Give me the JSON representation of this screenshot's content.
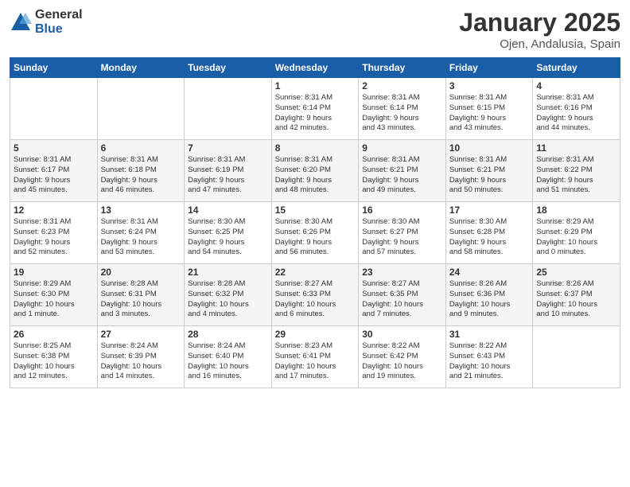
{
  "logo": {
    "general": "General",
    "blue": "Blue"
  },
  "header": {
    "month": "January 2025",
    "location": "Ojen, Andalusia, Spain"
  },
  "weekdays": [
    "Sunday",
    "Monday",
    "Tuesday",
    "Wednesday",
    "Thursday",
    "Friday",
    "Saturday"
  ],
  "weeks": [
    [
      {
        "day": "",
        "info": ""
      },
      {
        "day": "",
        "info": ""
      },
      {
        "day": "",
        "info": ""
      },
      {
        "day": "1",
        "info": "Sunrise: 8:31 AM\nSunset: 6:14 PM\nDaylight: 9 hours\nand 42 minutes."
      },
      {
        "day": "2",
        "info": "Sunrise: 8:31 AM\nSunset: 6:14 PM\nDaylight: 9 hours\nand 43 minutes."
      },
      {
        "day": "3",
        "info": "Sunrise: 8:31 AM\nSunset: 6:15 PM\nDaylight: 9 hours\nand 43 minutes."
      },
      {
        "day": "4",
        "info": "Sunrise: 8:31 AM\nSunset: 6:16 PM\nDaylight: 9 hours\nand 44 minutes."
      }
    ],
    [
      {
        "day": "5",
        "info": "Sunrise: 8:31 AM\nSunset: 6:17 PM\nDaylight: 9 hours\nand 45 minutes."
      },
      {
        "day": "6",
        "info": "Sunrise: 8:31 AM\nSunset: 6:18 PM\nDaylight: 9 hours\nand 46 minutes."
      },
      {
        "day": "7",
        "info": "Sunrise: 8:31 AM\nSunset: 6:19 PM\nDaylight: 9 hours\nand 47 minutes."
      },
      {
        "day": "8",
        "info": "Sunrise: 8:31 AM\nSunset: 6:20 PM\nDaylight: 9 hours\nand 48 minutes."
      },
      {
        "day": "9",
        "info": "Sunrise: 8:31 AM\nSunset: 6:21 PM\nDaylight: 9 hours\nand 49 minutes."
      },
      {
        "day": "10",
        "info": "Sunrise: 8:31 AM\nSunset: 6:21 PM\nDaylight: 9 hours\nand 50 minutes."
      },
      {
        "day": "11",
        "info": "Sunrise: 8:31 AM\nSunset: 6:22 PM\nDaylight: 9 hours\nand 51 minutes."
      }
    ],
    [
      {
        "day": "12",
        "info": "Sunrise: 8:31 AM\nSunset: 6:23 PM\nDaylight: 9 hours\nand 52 minutes."
      },
      {
        "day": "13",
        "info": "Sunrise: 8:31 AM\nSunset: 6:24 PM\nDaylight: 9 hours\nand 53 minutes."
      },
      {
        "day": "14",
        "info": "Sunrise: 8:30 AM\nSunset: 6:25 PM\nDaylight: 9 hours\nand 54 minutes."
      },
      {
        "day": "15",
        "info": "Sunrise: 8:30 AM\nSunset: 6:26 PM\nDaylight: 9 hours\nand 56 minutes."
      },
      {
        "day": "16",
        "info": "Sunrise: 8:30 AM\nSunset: 6:27 PM\nDaylight: 9 hours\nand 57 minutes."
      },
      {
        "day": "17",
        "info": "Sunrise: 8:30 AM\nSunset: 6:28 PM\nDaylight: 9 hours\nand 58 minutes."
      },
      {
        "day": "18",
        "info": "Sunrise: 8:29 AM\nSunset: 6:29 PM\nDaylight: 10 hours\nand 0 minutes."
      }
    ],
    [
      {
        "day": "19",
        "info": "Sunrise: 8:29 AM\nSunset: 6:30 PM\nDaylight: 10 hours\nand 1 minute."
      },
      {
        "day": "20",
        "info": "Sunrise: 8:28 AM\nSunset: 6:31 PM\nDaylight: 10 hours\nand 3 minutes."
      },
      {
        "day": "21",
        "info": "Sunrise: 8:28 AM\nSunset: 6:32 PM\nDaylight: 10 hours\nand 4 minutes."
      },
      {
        "day": "22",
        "info": "Sunrise: 8:27 AM\nSunset: 6:33 PM\nDaylight: 10 hours\nand 6 minutes."
      },
      {
        "day": "23",
        "info": "Sunrise: 8:27 AM\nSunset: 6:35 PM\nDaylight: 10 hours\nand 7 minutes."
      },
      {
        "day": "24",
        "info": "Sunrise: 8:26 AM\nSunset: 6:36 PM\nDaylight: 10 hours\nand 9 minutes."
      },
      {
        "day": "25",
        "info": "Sunrise: 8:26 AM\nSunset: 6:37 PM\nDaylight: 10 hours\nand 10 minutes."
      }
    ],
    [
      {
        "day": "26",
        "info": "Sunrise: 8:25 AM\nSunset: 6:38 PM\nDaylight: 10 hours\nand 12 minutes."
      },
      {
        "day": "27",
        "info": "Sunrise: 8:24 AM\nSunset: 6:39 PM\nDaylight: 10 hours\nand 14 minutes."
      },
      {
        "day": "28",
        "info": "Sunrise: 8:24 AM\nSunset: 6:40 PM\nDaylight: 10 hours\nand 16 minutes."
      },
      {
        "day": "29",
        "info": "Sunrise: 8:23 AM\nSunset: 6:41 PM\nDaylight: 10 hours\nand 17 minutes."
      },
      {
        "day": "30",
        "info": "Sunrise: 8:22 AM\nSunset: 6:42 PM\nDaylight: 10 hours\nand 19 minutes."
      },
      {
        "day": "31",
        "info": "Sunrise: 8:22 AM\nSunset: 6:43 PM\nDaylight: 10 hours\nand 21 minutes."
      },
      {
        "day": "",
        "info": ""
      }
    ]
  ]
}
